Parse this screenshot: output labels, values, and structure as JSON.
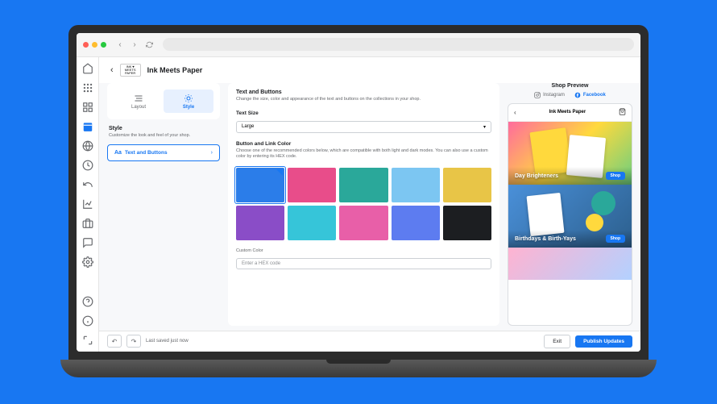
{
  "header": {
    "logo_text": "INK ♥ MEETS PAPER",
    "page_title": "Ink Meets Paper"
  },
  "tabs": {
    "layout": "Layout",
    "style": "Style"
  },
  "style_section": {
    "title": "Style",
    "desc": "Customize the look and feel of your shop."
  },
  "list_item": {
    "icon_text": "Aa",
    "label": "Text and Buttons"
  },
  "text_buttons": {
    "title": "Text and Buttons",
    "desc": "Change the size, color and appearance of the text and buttons on the collections in your shop.",
    "text_size_label": "Text Size",
    "text_size_value": "Large",
    "color_label": "Button and Link Color",
    "color_desc": "Choose one of the recommended colors below, which are compatible with both light and dark modes. You can also use a custom color by entering its HEX code.",
    "swatches": [
      "#2b7de9",
      "#e84d8a",
      "#2aa89a",
      "#7cc6f2",
      "#e8c547",
      "#8a4dc7",
      "#36c5d9",
      "#e85fa8",
      "#5d7cf0",
      "#1c1e21"
    ],
    "selected_index": 0,
    "custom_label": "Custom Color",
    "hex_placeholder": "Enter a HEX code"
  },
  "preview": {
    "title": "Shop Preview",
    "tab_instagram": "Instagram",
    "tab_facebook": "Facebook",
    "shop_name": "Ink Meets Paper",
    "cards": [
      {
        "title": "Day Brighteners",
        "btn": "Shop"
      },
      {
        "title": "Birthdays & Birth-Yays",
        "btn": "Shop"
      }
    ]
  },
  "footer": {
    "saved": "Last saved just now",
    "exit": "Exit",
    "publish": "Publish Updates"
  }
}
